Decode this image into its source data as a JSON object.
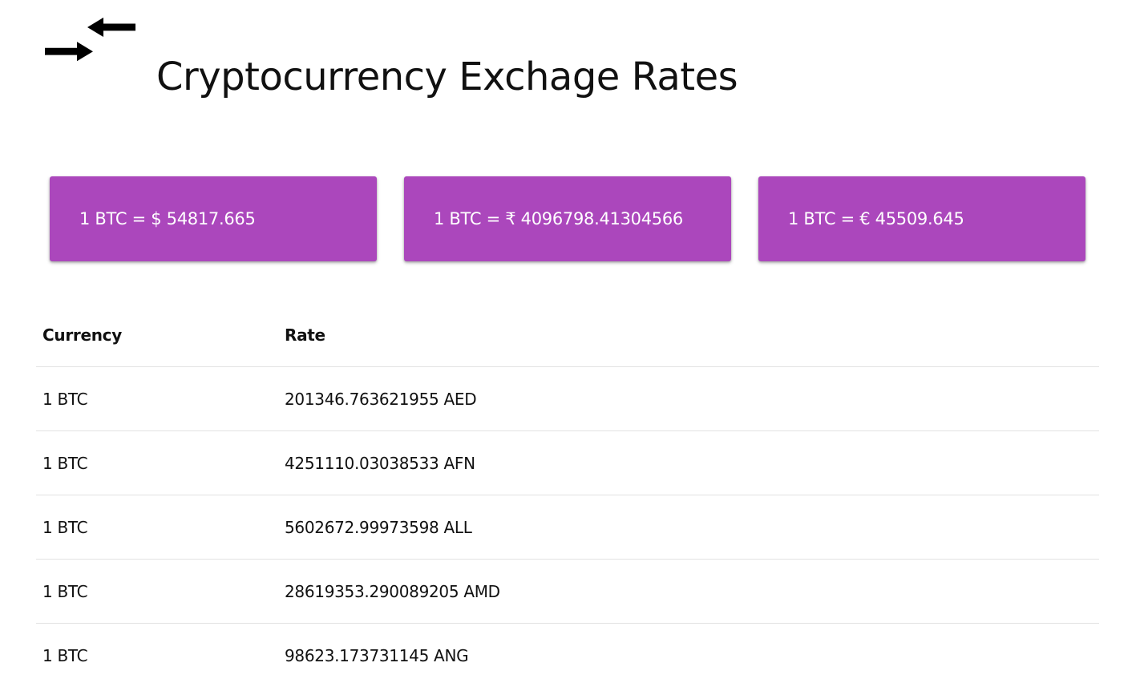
{
  "header": {
    "logo_icon": "exchange-arrows-icon",
    "title": "Cryptocurrency Exchage Rates"
  },
  "cards": [
    {
      "text": "1 BTC = $ 54817.665"
    },
    {
      "text": "1 BTC = ₹ 4096798.41304566"
    },
    {
      "text": "1 BTC = € 45509.645"
    }
  ],
  "table": {
    "headers": [
      "Currency",
      "Rate"
    ],
    "rows": [
      {
        "currency": "1 BTC",
        "rate": "201346.763621955 AED"
      },
      {
        "currency": "1 BTC",
        "rate": "4251110.03038533 AFN"
      },
      {
        "currency": "1 BTC",
        "rate": "5602672.99973598 ALL"
      },
      {
        "currency": "1 BTC",
        "rate": "28619353.290089205 AMD"
      },
      {
        "currency": "1 BTC",
        "rate": "98623.173731145 ANG"
      }
    ]
  },
  "colors": {
    "card_background": "#ab47bc",
    "card_text": "#ffffff",
    "row_divider": "#e2e2e2"
  }
}
